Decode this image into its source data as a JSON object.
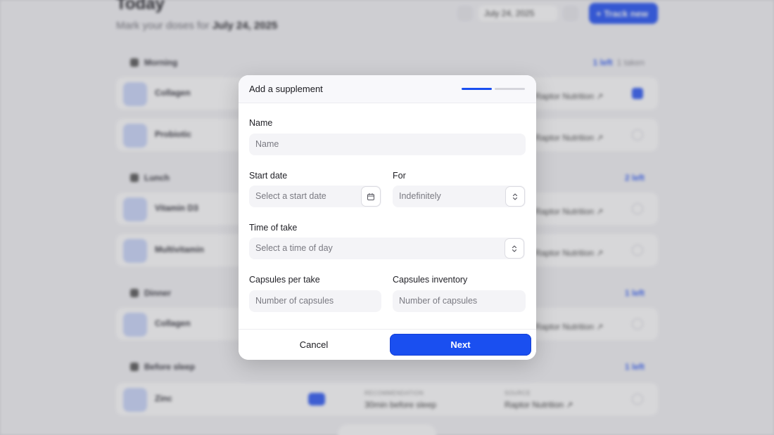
{
  "background": {
    "title": "Today",
    "subtitle_prefix": "Mark your doses for",
    "subtitle_date": "July 24, 2025",
    "date_picker": "July 24, 2025",
    "track_button": "+ Track new",
    "sections": [
      {
        "name": "Morning",
        "left": "1 left",
        "extra": "1 taken"
      },
      {
        "name": "Lunch",
        "left": "2 left",
        "extra": ""
      },
      {
        "name": "Dinner",
        "left": "1 left",
        "extra": ""
      },
      {
        "name": "Before sleep",
        "left": "1 left",
        "extra": ""
      }
    ],
    "items": [
      {
        "name": "Collagen",
        "source": "Raptor Nutrition ↗"
      },
      {
        "name": "Probiotic",
        "source": "Raptor Nutrition ↗"
      },
      {
        "name": "Vitamin D3",
        "source": "Raptor Nutrition ↗"
      },
      {
        "name": "Multivitamin",
        "source": "Raptor Nutrition ↗"
      },
      {
        "name": "Collagen",
        "source": "Raptor Nutrition ↗"
      },
      {
        "name": "Zinc",
        "recommendation_header": "RECOMMENDATION",
        "recommendation": "30min before sleep",
        "source_header": "SOURCE",
        "source": "Raptor Nutrition ↗"
      }
    ]
  },
  "modal": {
    "title": "Add a supplement",
    "steps_total": 2,
    "steps_completed": 1,
    "name_label": "Name",
    "name_placeholder": "Name",
    "start_date_label": "Start date",
    "start_date_placeholder": "Select a start date",
    "for_label": "For",
    "for_value": "Indefinitely",
    "time_label": "Time of take",
    "time_placeholder": "Select a time of day",
    "capsules_per_take_label": "Capsules per take",
    "capsules_per_take_placeholder": "Number of capsules",
    "capsules_inventory_label": "Capsules inventory",
    "capsules_inventory_placeholder": "Number of capsules",
    "cancel_label": "Cancel",
    "next_label": "Next"
  },
  "colors": {
    "accent": "#1a4ff0"
  }
}
